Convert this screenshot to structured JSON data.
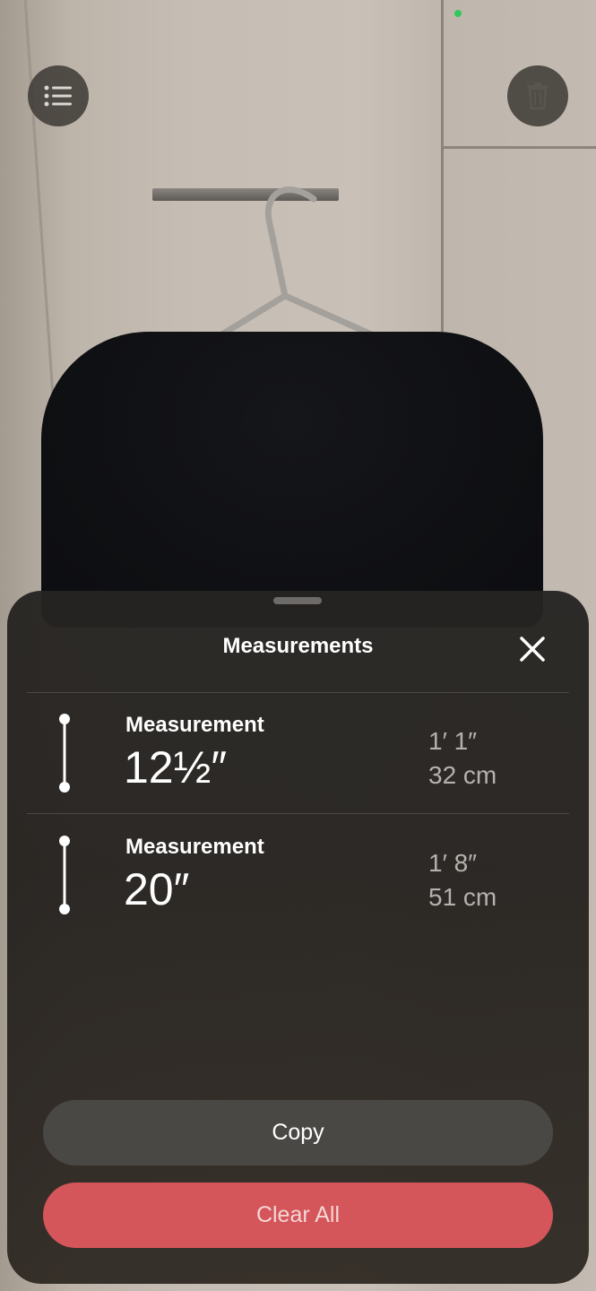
{
  "top_bar": {
    "list_icon": "list-icon",
    "trash_icon": "trash-icon",
    "status_dot_color": "#34c759"
  },
  "sheet": {
    "title": "Measurements",
    "close_icon": "close-icon",
    "measurements": [
      {
        "label": "Measurement",
        "value": "12½″",
        "alt_imperial": "1′ 1″",
        "alt_metric": "32 cm",
        "icon": "measure-line-icon"
      },
      {
        "label": "Measurement",
        "value": "20″",
        "alt_imperial": "1′ 8″",
        "alt_metric": "51 cm",
        "icon": "measure-line-icon"
      }
    ],
    "copy_label": "Copy",
    "clear_all_label": "Clear All"
  },
  "colors": {
    "destructive": "#d4555a",
    "secondary_button": "#4a4845",
    "sheet_background": "#262422"
  }
}
